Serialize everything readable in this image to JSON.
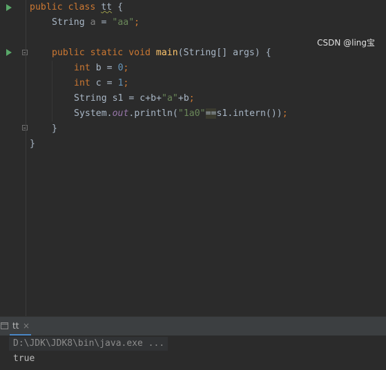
{
  "editor": {
    "line1": {
      "kw1": "public",
      "kw2": "class",
      "name": "tt",
      "brace": "{"
    },
    "line2": {
      "type": "String",
      "var": "a",
      "eq": "=",
      "str": "\"aa\"",
      "semi": ";"
    },
    "line3": {
      "kw1": "public",
      "kw2": "static",
      "kw3": "void",
      "method": "main",
      "params": "(String[] args) {"
    },
    "line4": {
      "kw": "int",
      "rest": "b =",
      "num": "0",
      "semi": ";"
    },
    "line5": {
      "kw": "int",
      "rest": "c =",
      "num": "1",
      "semi": ";"
    },
    "line6": {
      "pre": "String s1 = c+b+",
      "str": "\"a\"",
      "post": "+b",
      "semi": ";"
    },
    "line7": {
      "pre": "System.",
      "field": "out",
      "mid": ".println(",
      "str": "\"1a0\"",
      "op": "==",
      "post": "s1.intern())",
      "semi": ";"
    },
    "line8": {
      "brace": "}"
    },
    "line9": {
      "brace": "}"
    }
  },
  "run_panel": {
    "tab_label": "tt",
    "tab_close": "×",
    "command": "D:\\JDK\\JDK8\\bin\\java.exe ...",
    "output": "true"
  },
  "watermark": "CSDN @ling宝"
}
